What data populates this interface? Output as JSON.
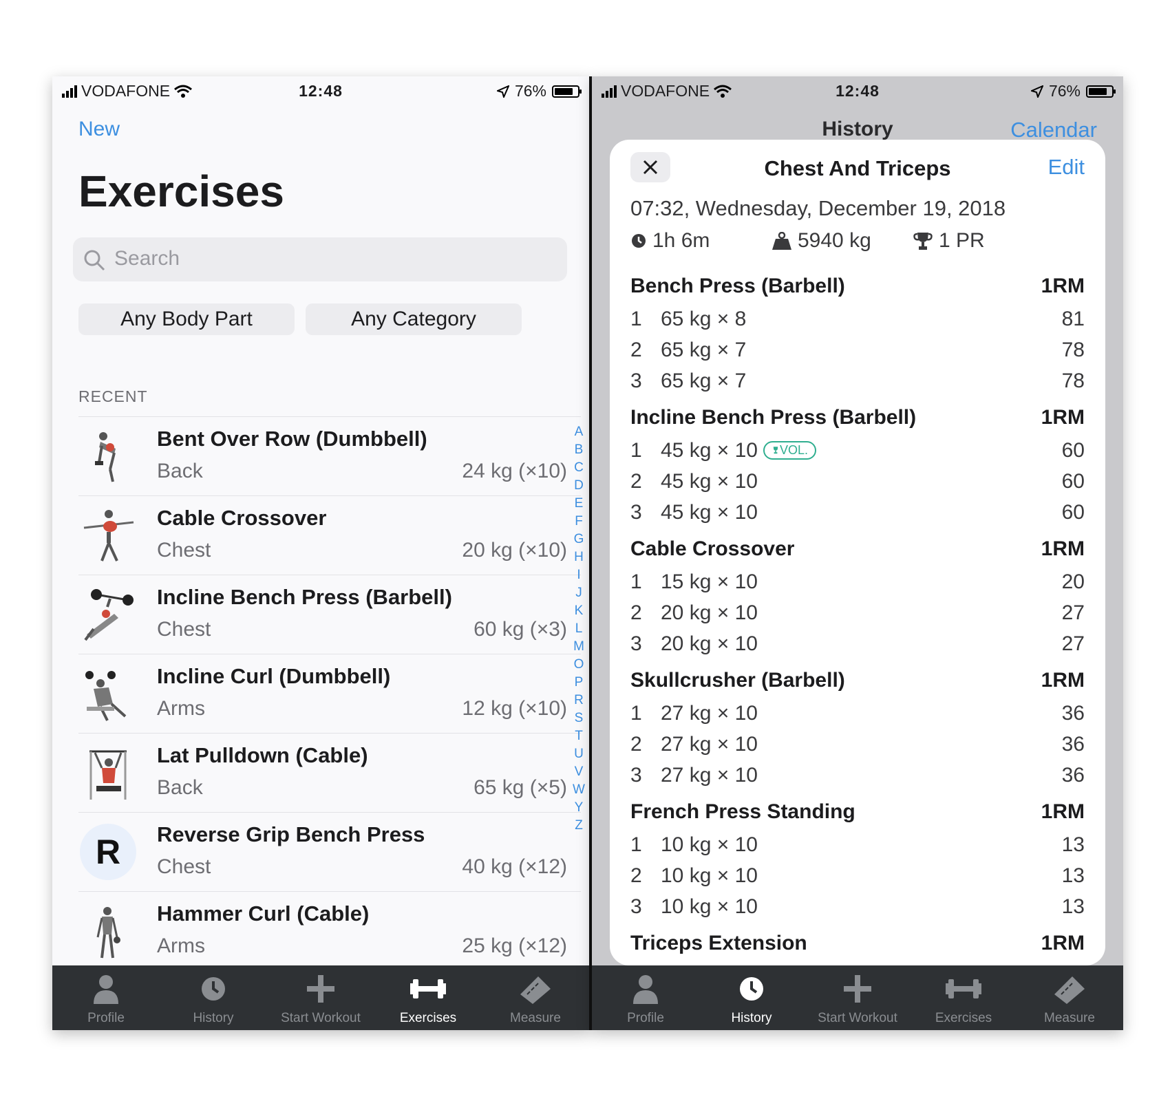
{
  "status": {
    "carrier": "VODAFONE",
    "time": "12:48",
    "battery": "76%"
  },
  "left": {
    "new_label": "New",
    "title": "Exercises",
    "search_placeholder": "Search",
    "filters": [
      "Any Body Part",
      "Any Category"
    ],
    "section": "RECENT",
    "exercises": [
      {
        "name": "Bent Over Row (Dumbbell)",
        "part": "Back",
        "best": "24 kg (×10)",
        "thumb": "exercise-illustration-icon"
      },
      {
        "name": "Cable Crossover",
        "part": "Chest",
        "best": "20 kg (×10)",
        "thumb": "exercise-illustration-icon"
      },
      {
        "name": "Incline Bench Press (Barbell)",
        "part": "Chest",
        "best": "60 kg (×3)",
        "thumb": "exercise-illustration-icon"
      },
      {
        "name": "Incline Curl (Dumbbell)",
        "part": "Arms",
        "best": "12 kg (×10)",
        "thumb": "exercise-illustration-icon"
      },
      {
        "name": "Lat Pulldown (Cable)",
        "part": "Back",
        "best": "65 kg (×5)",
        "thumb": "exercise-illustration-icon"
      },
      {
        "name": "Reverse Grip Bench Press",
        "part": "Chest",
        "best": "40 kg (×12)",
        "letter": "R"
      },
      {
        "name": "Hammer Curl (Cable)",
        "part": "Arms",
        "best": "25 kg (×12)",
        "thumb": "exercise-illustration-icon"
      }
    ],
    "index_letters": [
      "A",
      "B",
      "C",
      "D",
      "E",
      "F",
      "G",
      "H",
      "I",
      "J",
      "K",
      "L",
      "M",
      "O",
      "P",
      "R",
      "S",
      "T",
      "U",
      "V",
      "W",
      "Y",
      "Z"
    ]
  },
  "right": {
    "header_title": "History",
    "calendar_label": "Calendar",
    "workout_title": "Chest And Triceps",
    "edit_label": "Edit",
    "date": "07:32, Wednesday, December 19, 2018",
    "duration": "1h 6m",
    "volume": "5940 kg",
    "prs": "1 PR",
    "exercises": [
      {
        "name": "Bench Press (Barbell)",
        "col": "1RM",
        "sets": [
          {
            "n": "1",
            "w": "65 kg × 8",
            "v": "81"
          },
          {
            "n": "2",
            "w": "65 kg × 7",
            "v": "78"
          },
          {
            "n": "3",
            "w": "65 kg × 7",
            "v": "78"
          }
        ]
      },
      {
        "name": "Incline Bench Press (Barbell)",
        "col": "1RM",
        "sets": [
          {
            "n": "1",
            "w": "45 kg × 10",
            "v": "60",
            "badge": "VOL."
          },
          {
            "n": "2",
            "w": "45 kg × 10",
            "v": "60"
          },
          {
            "n": "3",
            "w": "45 kg × 10",
            "v": "60"
          }
        ]
      },
      {
        "name": "Cable Crossover",
        "col": "1RM",
        "sets": [
          {
            "n": "1",
            "w": "15 kg × 10",
            "v": "20"
          },
          {
            "n": "2",
            "w": "20 kg × 10",
            "v": "27"
          },
          {
            "n": "3",
            "w": "20 kg × 10",
            "v": "27"
          }
        ]
      },
      {
        "name": "Skullcrusher (Barbell)",
        "col": "1RM",
        "sets": [
          {
            "n": "1",
            "w": "27 kg × 10",
            "v": "36"
          },
          {
            "n": "2",
            "w": "27 kg × 10",
            "v": "36"
          },
          {
            "n": "3",
            "w": "27 kg × 10",
            "v": "36"
          }
        ]
      },
      {
        "name": "French Press Standing",
        "col": "1RM",
        "sets": [
          {
            "n": "1",
            "w": "10 kg × 10",
            "v": "13"
          },
          {
            "n": "2",
            "w": "10 kg × 10",
            "v": "13"
          },
          {
            "n": "3",
            "w": "10 kg × 10",
            "v": "13"
          }
        ]
      },
      {
        "name": "Triceps Extension",
        "col": "1RM",
        "sets": []
      }
    ]
  },
  "tabs": [
    "Profile",
    "History",
    "Start Workout",
    "Exercises",
    "Measure"
  ],
  "active_tab_left": "Exercises",
  "active_tab_right": "History",
  "colors": {
    "accent": "#3d8fe0",
    "tabbar": "#2e3134",
    "volume_badge": "#2fae8f"
  }
}
